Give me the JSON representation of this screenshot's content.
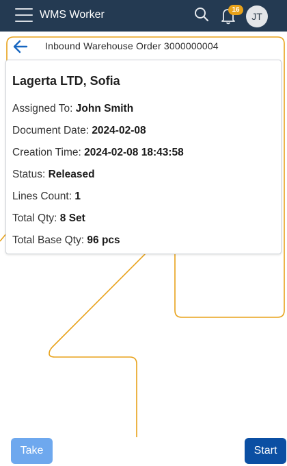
{
  "header": {
    "app_title": "WMS Worker",
    "notification_count": "16",
    "avatar_initials": "JT"
  },
  "page": {
    "title": "Inbound Warehouse Order 3000000004"
  },
  "order": {
    "customer": "Lagerta LTD, Sofia",
    "fields": [
      {
        "label": "Assigned To:",
        "value": "John Smith"
      },
      {
        "label": "Document Date:",
        "value": "2024-02-08"
      },
      {
        "label": "Creation Time:",
        "value": "2024-02-08 18:43:58"
      },
      {
        "label": "Status:",
        "value": "Released"
      },
      {
        "label": "Lines Count:",
        "value": "1"
      },
      {
        "label": "Total Qty:",
        "value": "8 Set"
      },
      {
        "label": "Total Base Qty:",
        "value": "96 pcs"
      }
    ]
  },
  "actions": {
    "take_label": "Take",
    "start_label": "Start"
  },
  "colors": {
    "header_bg": "#243a52",
    "accent_line": "#e8a21a",
    "take_button": "#6ea8ee",
    "start_button": "#0b4fa3"
  }
}
